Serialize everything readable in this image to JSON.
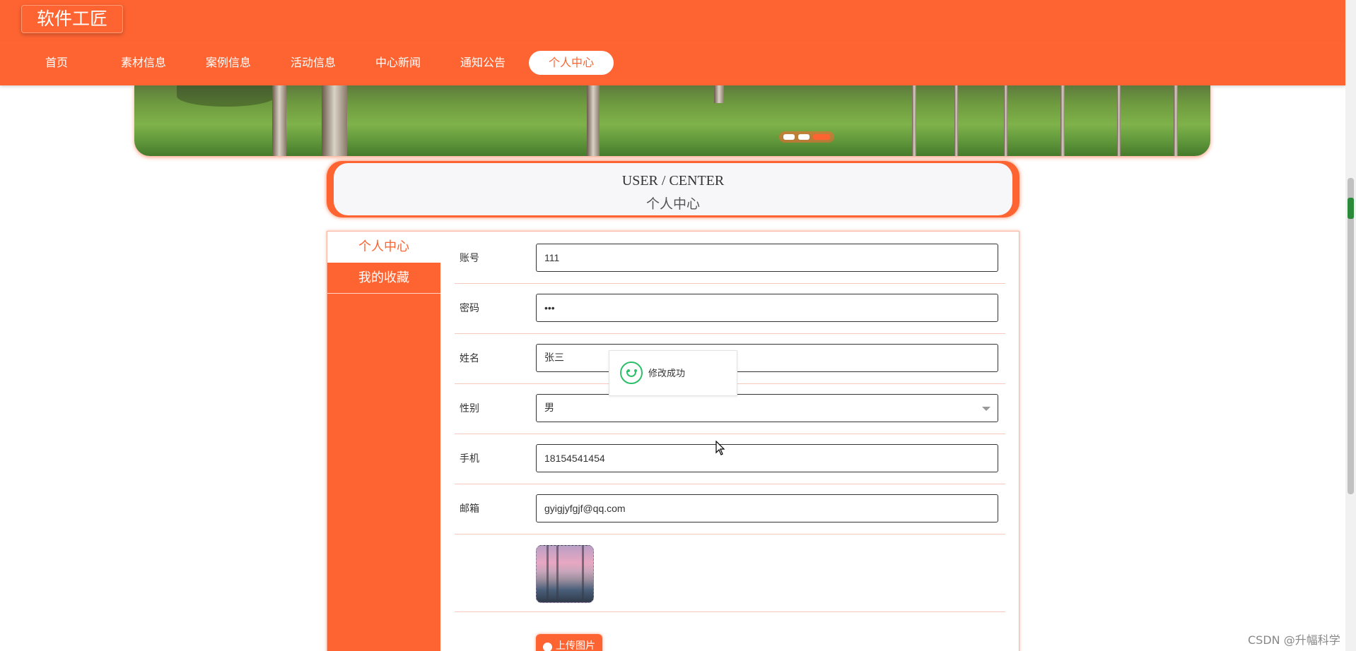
{
  "site": {
    "logo": "软件工匠"
  },
  "nav": {
    "items": [
      {
        "label": "首页",
        "active": false
      },
      {
        "label": "素材信息",
        "active": false
      },
      {
        "label": "案例信息",
        "active": false
      },
      {
        "label": "活动信息",
        "active": false
      },
      {
        "label": "中心新闻",
        "active": false
      },
      {
        "label": "通知公告",
        "active": false
      },
      {
        "label": "个人中心",
        "active": true
      }
    ]
  },
  "banner": {
    "slides": 3,
    "active_slide": 3
  },
  "section": {
    "title_en": "USER / CENTER",
    "title_cn": "个人中心"
  },
  "sidebar": {
    "items": [
      {
        "label": "个人中心",
        "active": true
      },
      {
        "label": "我的收藏",
        "active": false
      }
    ]
  },
  "form": {
    "account": {
      "label": "账号",
      "value": "111"
    },
    "password": {
      "label": "密码",
      "value": "•••"
    },
    "name": {
      "label": "姓名",
      "value": "张三"
    },
    "gender": {
      "label": "性别",
      "value": "男"
    },
    "phone": {
      "label": "手机",
      "value": "18154541454"
    },
    "email": {
      "label": "邮箱",
      "value": "gyigjyfgjf@qq.com"
    },
    "upload_label": "上传图片"
  },
  "toast": {
    "message": "修改成功",
    "icon": "smile-icon"
  },
  "colors": {
    "accent": "#fd6432",
    "toast_icon": "#2dbf6a"
  },
  "watermark": "CSDN @升幅科学"
}
